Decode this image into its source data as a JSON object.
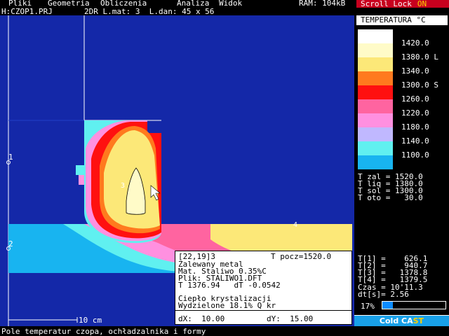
{
  "menu": [
    "Pliki",
    "Geometria",
    "Obliczenia",
    "Analiza",
    "Widok"
  ],
  "ram": "RAM: 104kB",
  "scroll_lock": {
    "label": "Scroll Lock",
    "state": "ON"
  },
  "project": "H:CZOP1.PRJ",
  "model": "2DR L.mat: 3  L.dan: 45 x 56",
  "field": {
    "sensor_labels": [
      "1",
      "2",
      "3",
      "4"
    ],
    "scale_label": "10 cm"
  },
  "legend": {
    "title": "TEMPERATURA °C",
    "entries": [
      {
        "color": "#ffffff",
        "label": "1420.0"
      },
      {
        "color": "#fffbc8",
        "label": "1380.0 L"
      },
      {
        "color": "#fce878",
        "label": "1340.0"
      },
      {
        "color": "#ff7a1e",
        "label": "1300.0 S"
      },
      {
        "color": "#ff1010",
        "label": "1260.0"
      },
      {
        "color": "#ff64a0",
        "label": "1220.0"
      },
      {
        "color": "#ff90e0",
        "label": "1180.0"
      },
      {
        "color": "#c0b8ff",
        "label": "1140.0"
      },
      {
        "color": "#60f0f0",
        "label": "1100.0"
      },
      {
        "color": "#18b4f0",
        "label": ""
      }
    ]
  },
  "temps": [
    "T zal = 1520.0",
    "T liq = 1380.0",
    "T sol = 1300.0",
    "T oto =   30.0"
  ],
  "sensors": [
    "T[1] =    626.1",
    "T[2] =    940.7",
    "T[3] =   1378.8",
    "T[4] =   1379.5"
  ],
  "time": [
    "Czas = 10'11.3",
    "dt[s]= 2.56"
  ],
  "progress": {
    "label": "17%",
    "value": 0.17
  },
  "brand": {
    "main": "Cold CA",
    "accent": "ST"
  },
  "info": {
    "coords": "[22,19]3",
    "t_start": "T pocz=1520.0",
    "line1": "Zalewany metal",
    "line2": "Mat. Staliwo 0.35%C",
    "line3": "Plik: STALIWO1.DFT",
    "line4": "T 1376.94   dT -0.0542",
    "line5": "Ciepło krystalizacji",
    "line6": "Wydzielone 18.1% Q kr",
    "dx": "dX:  10.00",
    "dy": "dY:  15.00"
  },
  "bottom_status": "Pole temperatur czopa, ochładzalnika i formy"
}
